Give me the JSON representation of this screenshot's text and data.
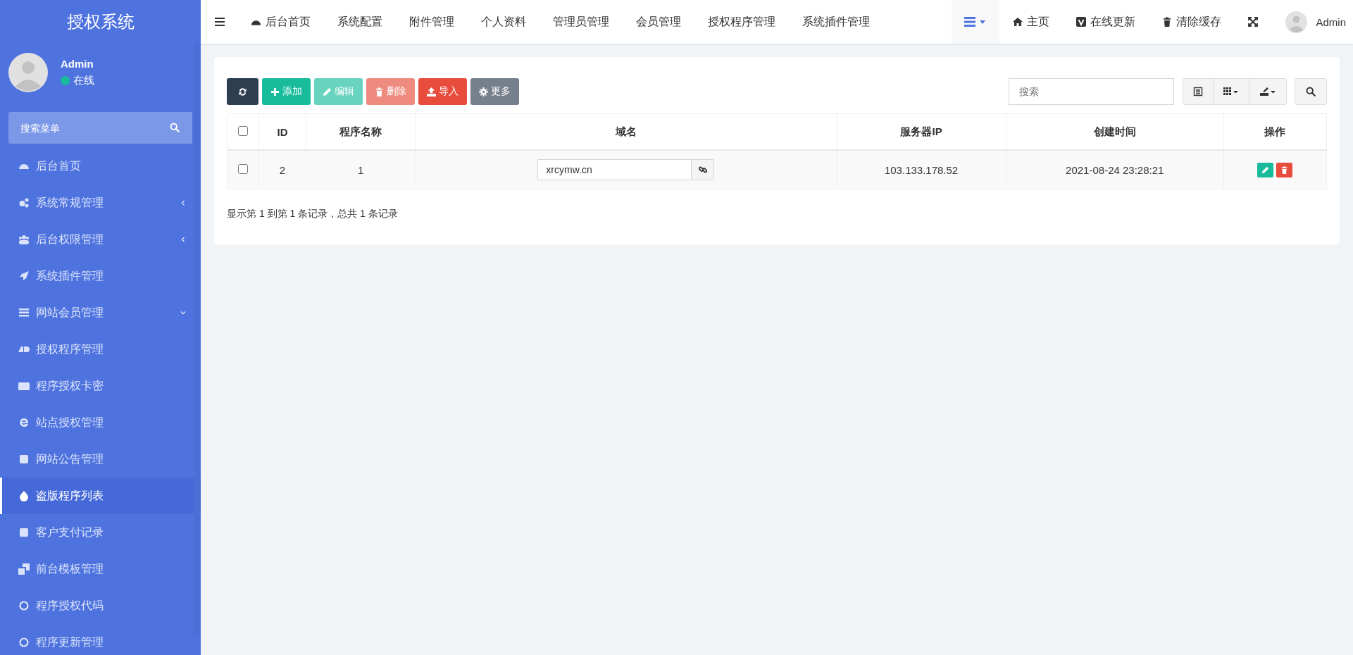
{
  "sidebar": {
    "logo": "授权系统",
    "user": {
      "name": "Admin",
      "status": "在线",
      "online": true
    },
    "search": {
      "placeholder": "搜索菜单"
    },
    "items": [
      {
        "label": "后台首页",
        "kind": "link",
        "selected": false
      },
      {
        "label": "系统常规管理",
        "kind": "group",
        "expanded": false,
        "selected": false
      },
      {
        "label": "后台权限管理",
        "kind": "group",
        "expanded": false,
        "selected": false
      },
      {
        "label": "系统插件管理",
        "kind": "link",
        "selected": false
      },
      {
        "label": "网站会员管理",
        "kind": "group",
        "expanded": true,
        "selected": false
      },
      {
        "label": "授权程序管理",
        "kind": "link",
        "selected": false
      },
      {
        "label": "程序授权卡密",
        "kind": "link",
        "selected": false
      },
      {
        "label": "站点授权管理",
        "kind": "link",
        "selected": false
      },
      {
        "label": "网站公告管理",
        "kind": "link",
        "selected": false
      },
      {
        "label": "盗版程序列表",
        "kind": "link",
        "selected": true
      },
      {
        "label": "客户支付记录",
        "kind": "link",
        "selected": false
      },
      {
        "label": "前台模板管理",
        "kind": "link",
        "selected": false
      },
      {
        "label": "程序授权代码",
        "kind": "link",
        "selected": false
      },
      {
        "label": "程序更新管理",
        "kind": "link",
        "selected": false
      }
    ]
  },
  "topnav": {
    "tabs": [
      {
        "label": "后台首页",
        "selected": false
      },
      {
        "label": "系统配置",
        "selected": false
      },
      {
        "label": "附件管理",
        "selected": false
      },
      {
        "label": "个人资料",
        "selected": false
      },
      {
        "label": "管理员管理",
        "selected": false
      },
      {
        "label": "会员管理",
        "selected": false
      },
      {
        "label": "授权程序管理",
        "selected": false
      },
      {
        "label": "系统插件管理",
        "selected": false
      }
    ],
    "right": [
      {
        "label": "主页",
        "kind": "home"
      },
      {
        "label": "在线更新",
        "kind": "update"
      },
      {
        "label": "清除缓存",
        "kind": "trash"
      }
    ],
    "user": "Admin"
  },
  "toolbar": {
    "buttons": [
      {
        "kind": "refresh",
        "disabled": false
      },
      {
        "kind": "add",
        "label": "添加",
        "disabled": false
      },
      {
        "kind": "edit",
        "label": "编辑",
        "disabled": true
      },
      {
        "kind": "delete",
        "label": "删除",
        "disabled": true
      },
      {
        "kind": "import",
        "label": "导入",
        "disabled": false
      },
      {
        "kind": "more",
        "label": "更多",
        "disabled": false
      }
    ],
    "search": {
      "placeholder": "搜索"
    }
  },
  "table": {
    "columns": [
      "ID",
      "程序名称",
      "域名",
      "服务器IP",
      "创建时间",
      "操作"
    ],
    "header_checked": false,
    "rows": [
      {
        "checked": false,
        "id": "2",
        "name": "1",
        "domain": "xrcymw.cn",
        "ip": "103.133.178.52",
        "created": "2021-08-24 23:28:21"
      }
    ]
  },
  "pagination_info": "显示第 1 到第 1 条记录，总共 1 条记录"
}
